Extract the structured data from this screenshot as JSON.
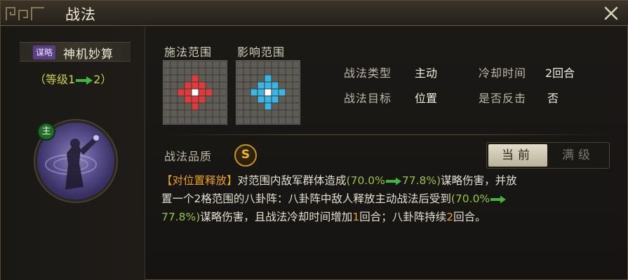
{
  "window": {
    "title": "战法",
    "close_icon": "close-icon"
  },
  "skill": {
    "type_tag": "谋略",
    "name": "神机妙算",
    "level_prefix": "（等级1",
    "level_suffix": "2）",
    "main_badge": "主"
  },
  "ranges": {
    "cast_label": "施法范围",
    "effect_label": "影响范围",
    "cast_color": "#e23a3a",
    "effect_color": "#38b6e6"
  },
  "info": {
    "type_label": "战法类型",
    "type_value": "主动",
    "target_label": "战法目标",
    "target_value": "位置",
    "cooldown_label": "冷却时间",
    "cooldown_value": "2回合",
    "counter_label": "是否反击",
    "counter_value": "否"
  },
  "quality": {
    "label": "战法品质",
    "grade": "S"
  },
  "toggle": {
    "current": "当前",
    "max": "满级"
  },
  "description": {
    "bracket": "【对位置释放】",
    "p1": "对范围内敌军群体造成",
    "v1_open": "(70.0%",
    "v1_close": "77.8%)",
    "p2": "谋略伤害，并放",
    "p3": "置一个2格范围的八卦阵：八卦阵中敌人释放主动战法后受到",
    "v2_open": "(70.0%",
    "v2_close": "77.8%)",
    "p4": "谋略伤害，且战法冷却时间增加",
    "n1": "1",
    "p5": "回合；八卦阵持续",
    "n2": "2",
    "p6": "回合。"
  },
  "colors": {
    "orange": "#e8a31c",
    "green": "#97c43e",
    "gold_border": "#c9941e"
  }
}
